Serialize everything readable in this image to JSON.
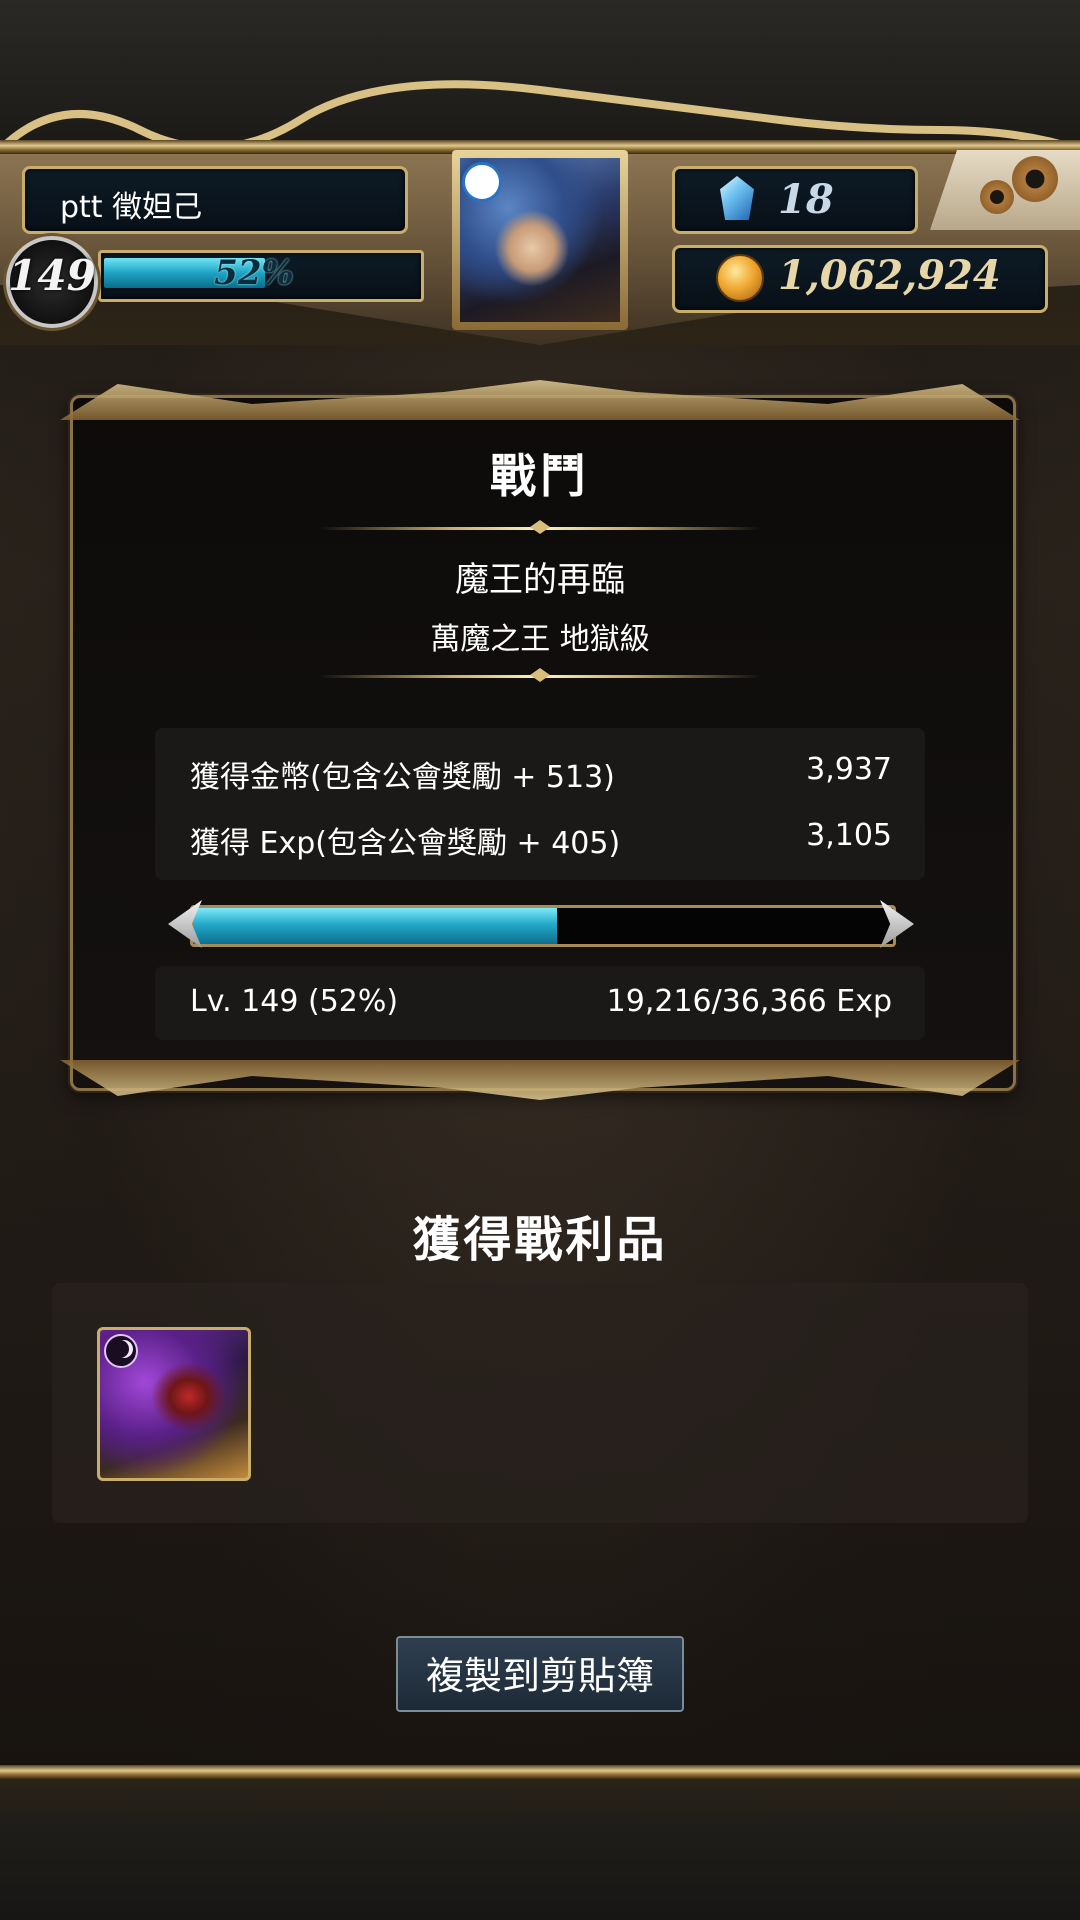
{
  "header": {
    "player_name": "ptt 徵妲己",
    "level": "149",
    "exp_percent_text": "52%",
    "exp_fraction": 0.52,
    "gems": "18",
    "coins": "1,062,924",
    "icons": {
      "gem": "blue-crystal-icon",
      "coin": "gold-coin-icon",
      "settings": "gears-icon"
    }
  },
  "battle": {
    "title": "戰鬥",
    "stage_name": "魔王的再臨",
    "stage_subtitle": "萬魔之王 地獄級",
    "rewards": [
      {
        "label": "獲得金幣(包含公會獎勵 + 513)",
        "value": "3,937"
      },
      {
        "label": "獲得 Exp(包含公會獎勵 + 405)",
        "value": "3,105"
      }
    ],
    "progress_fraction": 0.52,
    "level_text": "Lv. 149 (52%)",
    "exp_text": "19,216/36,366 Exp"
  },
  "loot": {
    "title": "獲得戰利品",
    "items": [
      {
        "icon": "dark-demon-king-card-icon"
      }
    ]
  },
  "actions": {
    "copy_label": "複製到剪貼簿"
  },
  "colors": {
    "accent_gold": "#c9ad6a",
    "exp_bar": "#23a9c9",
    "button_bg": "#1d2a37"
  }
}
